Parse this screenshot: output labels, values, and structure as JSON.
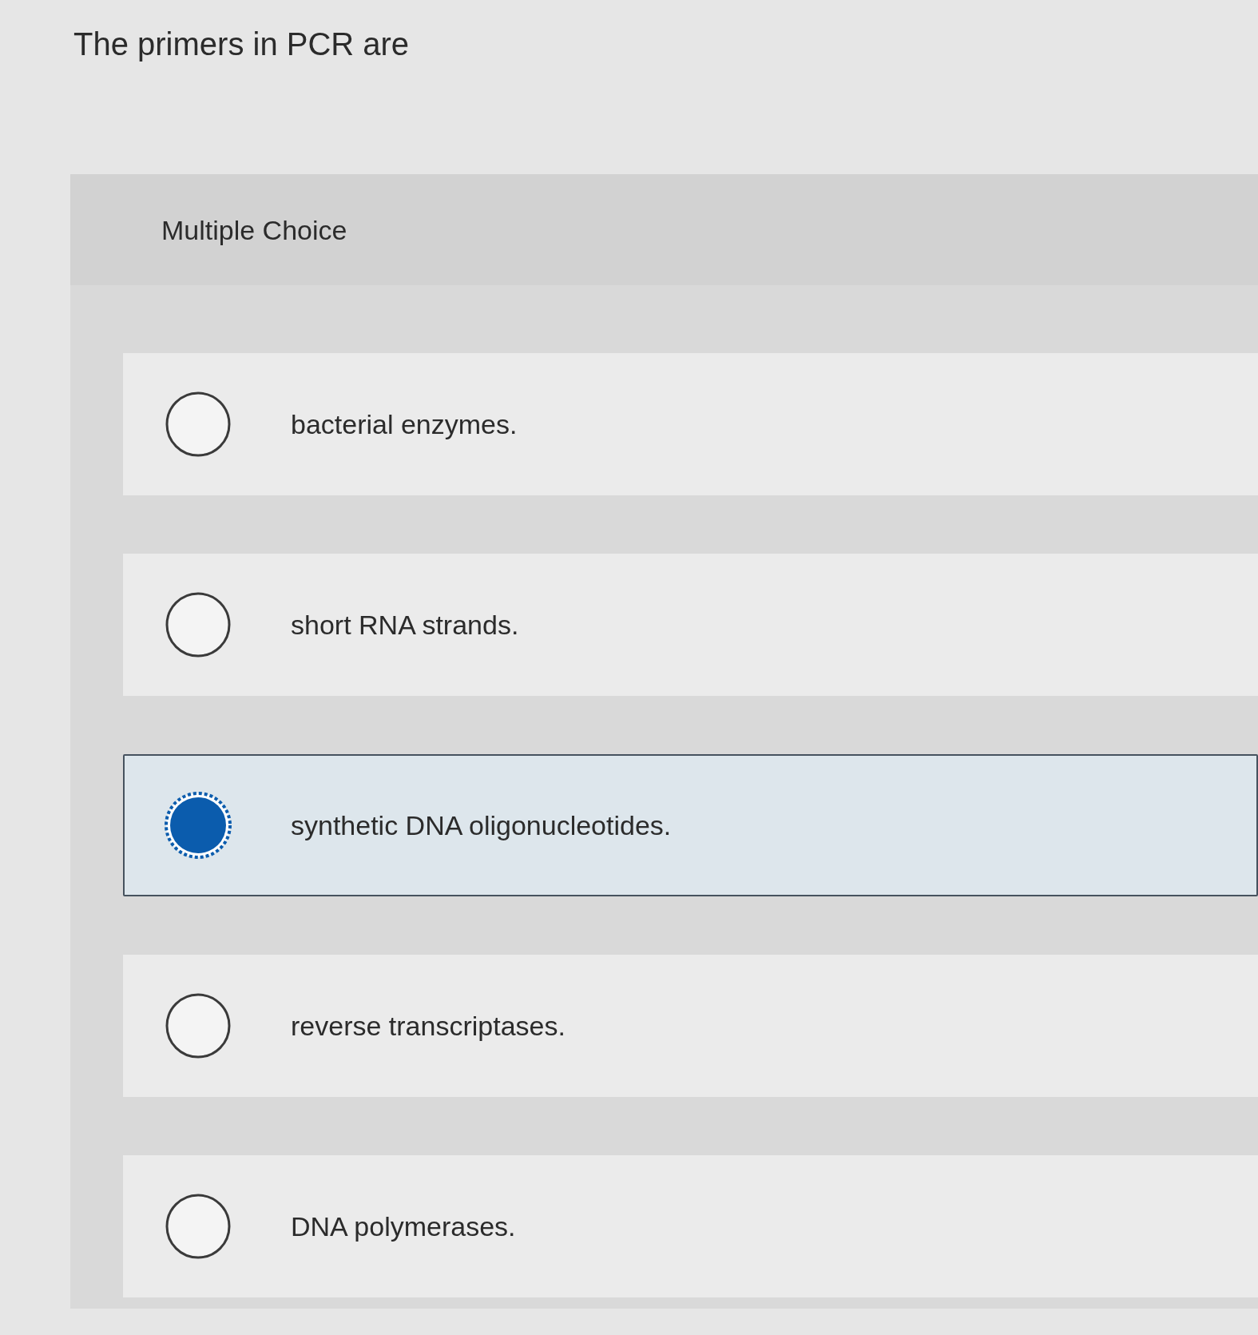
{
  "question": {
    "text": "The primers in PCR are"
  },
  "panel": {
    "type_label": "Multiple Choice"
  },
  "options": [
    {
      "label": "bacterial enzymes.",
      "selected": false
    },
    {
      "label": "short RNA strands.",
      "selected": false
    },
    {
      "label": "synthetic DNA oligonucleotides.",
      "selected": true
    },
    {
      "label": "reverse transcriptases.",
      "selected": false
    },
    {
      "label": "DNA polymerases.",
      "selected": false
    }
  ]
}
